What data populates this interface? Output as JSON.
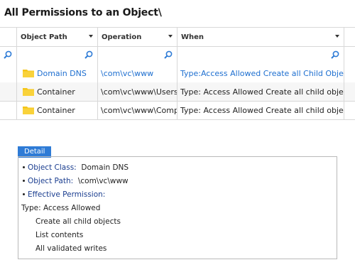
{
  "title": "All Permissions to an Object\\",
  "columns": [
    "Object Path",
    "Operation",
    "When"
  ],
  "rows": [
    {
      "object": "Domain DNS",
      "operation": "\\com\\vc\\www",
      "when": "Type:Access Allowed Create all Child Objects..."
    },
    {
      "object": "Container",
      "operation": "\\com\\vc\\www\\Users",
      "when": "Type: Access Allowed Create all child objects..."
    },
    {
      "object": "Container",
      "operation": "\\com\\vc\\www\\Comp...",
      "when": "Type: Access Allowed Create all child objects..."
    }
  ],
  "detail": {
    "tab_label": "Detail",
    "object_class_label": "Object Class:",
    "object_class_value": "Domain DNS",
    "object_path_label": "Object Path:",
    "object_path_value": "\\com\\vc\\www",
    "effective_permission_label": "Effective Permission:",
    "type_line": "Type: Access Allowed",
    "permissions": [
      "Create all child objects",
      "List contents",
      "All validated writes"
    ]
  },
  "colors": {
    "accent": "#2e7bd6",
    "link": "#1e6fd0",
    "folder": "#f5c518"
  },
  "icons": {
    "filter": "search-icon",
    "row": "folder-icon",
    "sort": "chevron-down-icon"
  }
}
